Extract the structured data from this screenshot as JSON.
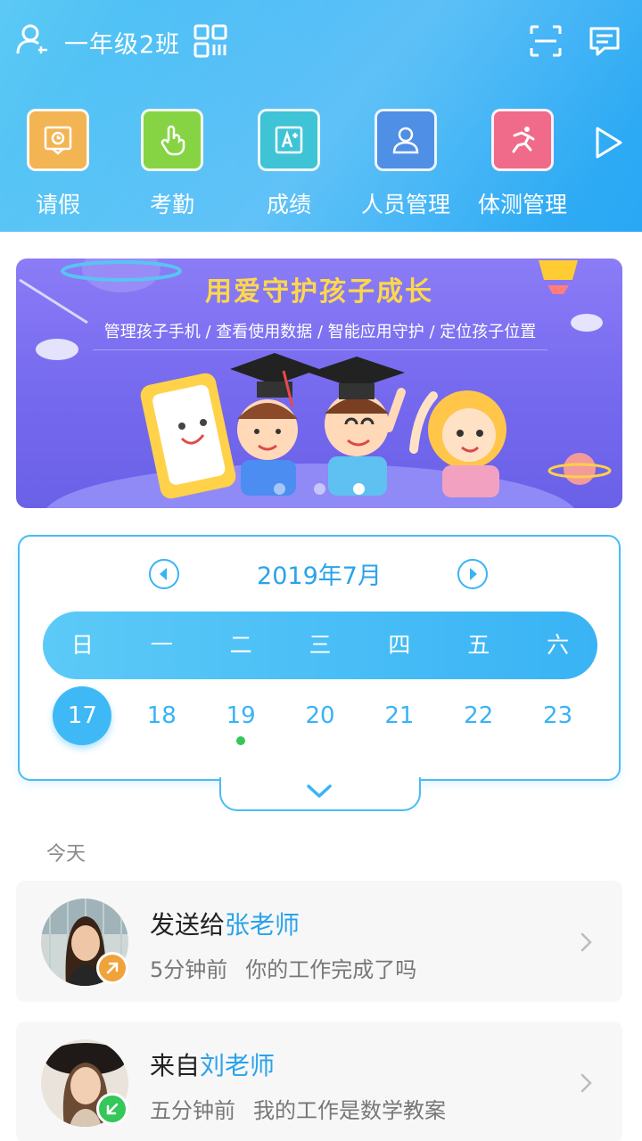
{
  "header": {
    "class_name": "一年级2班",
    "icons": {
      "user": "user-icon",
      "qr": "qr-code-icon",
      "scan": "scan-icon",
      "message": "message-icon"
    },
    "shortcuts": [
      {
        "label": "请假",
        "icon": "leave-icon",
        "color": "#f3b454"
      },
      {
        "label": "考勤",
        "icon": "attendance-icon",
        "color": "#86d444"
      },
      {
        "label": "成绩",
        "icon": "grades-icon",
        "color": "#3fc3d6"
      },
      {
        "label": "人员管理",
        "icon": "people-icon",
        "color": "#4f8fe6"
      },
      {
        "label": "体测管理",
        "icon": "fitness-icon",
        "color": "#f06a8a"
      }
    ]
  },
  "banner": {
    "headline": "用爱守护孩子成长",
    "subline": "管理孩子手机 / 查看使用数据 / 智能应用守护 / 定位孩子位置",
    "slides": 3,
    "active_slide": 3
  },
  "calendar": {
    "month": "2019年7月",
    "weekdays": [
      "日",
      "一",
      "二",
      "三",
      "四",
      "五",
      "六"
    ],
    "days": [
      "17",
      "18",
      "19",
      "20",
      "21",
      "22",
      "23"
    ],
    "selected_day": "17",
    "marked_day": "19"
  },
  "feed": {
    "section_label": "今天",
    "items": [
      {
        "title_prefix": "发送给",
        "person": "张老师",
        "time": "5分钟前",
        "message": "你的工作完成了吗",
        "badge_color": "#f0a33a",
        "badge_icon": "arrow-up-right-icon"
      },
      {
        "title_prefix": "来自",
        "person": "刘老师",
        "time": "五分钟前",
        "message": "我的工作是数学教案",
        "badge_color": "#34c759",
        "badge_icon": "arrow-down-left-icon"
      }
    ]
  },
  "colors": {
    "accent": "#39b3f5",
    "header_start": "#5cc9f5",
    "header_end": "#2aa8f4",
    "banner": "#7569ee"
  }
}
